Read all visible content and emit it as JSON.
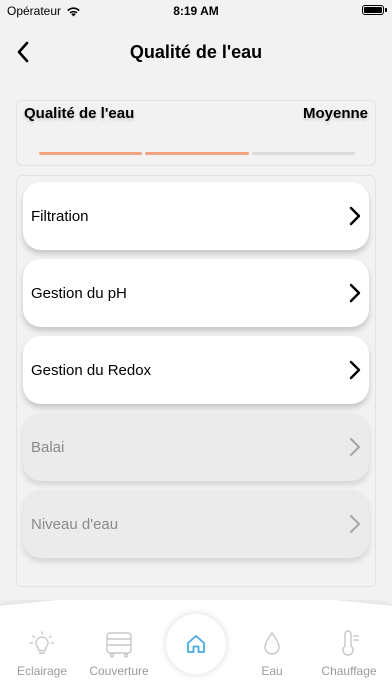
{
  "status_bar": {
    "carrier": "Opérateur",
    "time": "8:19 AM"
  },
  "header": {
    "title": "Qualité de l'eau"
  },
  "quality": {
    "label": "Qualité de l'eau",
    "value": "Moyenne",
    "level_segments_on": 2,
    "level_segments_total": 3,
    "accent": "#f3a47f"
  },
  "menu": {
    "items": [
      {
        "label": "Filtration",
        "enabled": true
      },
      {
        "label": "Gestion du pH",
        "enabled": true
      },
      {
        "label": "Gestion du Redox",
        "enabled": true
      },
      {
        "label": "Balai",
        "enabled": false
      },
      {
        "label": "Niveau d'eau",
        "enabled": false
      }
    ]
  },
  "tabs": {
    "items": [
      {
        "label": "Eclairage",
        "icon": "bulb-icon"
      },
      {
        "label": "Couverture",
        "icon": "cover-icon"
      },
      {
        "label": "",
        "icon": "home-icon",
        "active": true,
        "color": "#4aa8e0"
      },
      {
        "label": "Eau",
        "icon": "drop-icon"
      },
      {
        "label": "Chauffage",
        "icon": "thermometer-icon"
      }
    ]
  }
}
